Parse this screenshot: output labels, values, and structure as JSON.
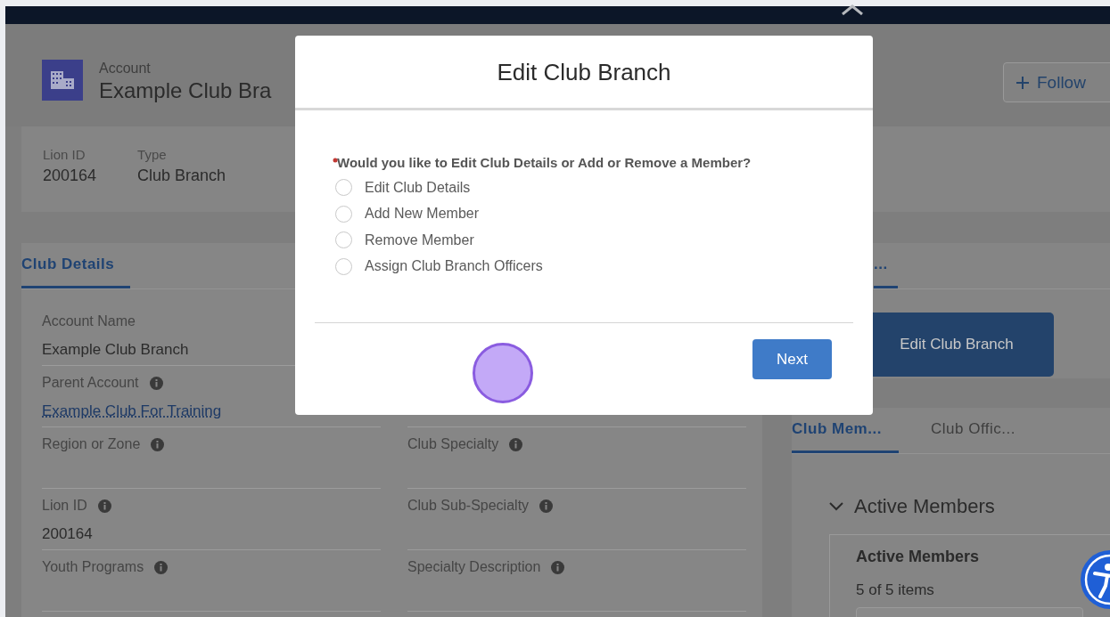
{
  "record_header": {
    "object_type": "Account",
    "title": "Example Club Bra",
    "follow_button": "Follow"
  },
  "highlights": [
    {
      "label": "Lion ID",
      "value": "200164"
    },
    {
      "label": "Type",
      "value": "Club Branch"
    }
  ],
  "details_tabs": [
    {
      "label": "Club Details",
      "selected": true
    }
  ],
  "detail_rows": [
    {
      "left": {
        "label": "Account Name",
        "value": "Example Club Branch",
        "info": false,
        "kind": "text"
      },
      "right": null
    },
    {
      "left": {
        "label": "Parent Account",
        "value": "Example Club For Training",
        "info": true,
        "kind": "link"
      },
      "right": null
    },
    {
      "left": {
        "label": "Region or Zone",
        "info": true
      },
      "right": {
        "label": "Club Specialty",
        "info": true
      }
    },
    {
      "left": {
        "label": "Lion ID",
        "value": "200164",
        "info": true,
        "kind": "text"
      },
      "right": {
        "label": "Club Sub-Specialty",
        "info": true
      }
    },
    {
      "left": {
        "label": "Youth Programs",
        "info": true
      },
      "right": {
        "label": "Specialty Description",
        "info": true
      }
    }
  ],
  "side_tabs": [
    {
      "label": "...",
      "selected": true
    }
  ],
  "action_button": "Edit Club Branch",
  "related_tabs": [
    {
      "label": "Club Mem...",
      "selected": true
    },
    {
      "label": "Club Offic...",
      "selected": false
    }
  ],
  "section": {
    "title": "Active Members",
    "expanded": true,
    "card_title": "Active Members",
    "count": "5 of 5 items"
  },
  "modal": {
    "title": "Edit Club Branch",
    "question": "Would you like to Edit Club Details or Add or Remove a Member?",
    "required": true,
    "options": [
      {
        "label": "Edit Club Details",
        "selected": false
      },
      {
        "label": "Add New Member",
        "selected": false
      },
      {
        "label": "Remove Member",
        "selected": false
      },
      {
        "label": "Assign Club Branch Officers",
        "selected": false
      }
    ],
    "next_button": "Next"
  }
}
